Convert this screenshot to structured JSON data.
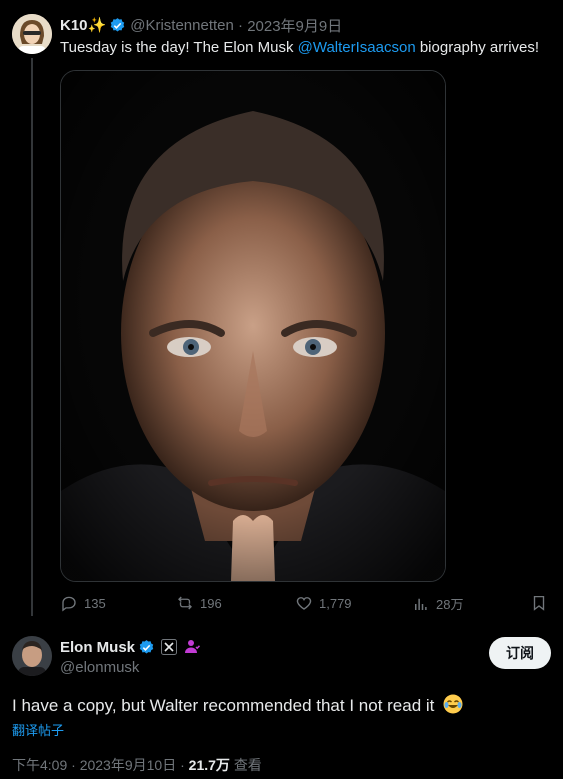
{
  "tweet": {
    "author_name": "K10",
    "author_name_emoji": "✨",
    "handle": "@Kristennetten",
    "date": "2023年9月9日",
    "text_prefix": "Tuesday is the day! The Elon Musk ",
    "mention": "@WalterIsaacson",
    "text_suffix": " biography arrives!",
    "actions": {
      "replies": "135",
      "reposts": "196",
      "likes": "1,779",
      "views": "28万"
    }
  },
  "reply": {
    "author_name": "Elon Musk",
    "handle": "@elonmusk",
    "follow_label": "订阅",
    "text": "I have a copy, but Walter recommended that I not read it",
    "translate_label": "翻译帖子",
    "time": "下午4:09",
    "date": "2023年9月10日",
    "views_count": "21.7万",
    "views_label": "查看"
  },
  "colors": {
    "background": "#000000",
    "text": "#e7e9ea",
    "muted": "#71767b",
    "link": "#1d9bf0",
    "verified": "#1d9bf0",
    "affiliate": "#c23bd4"
  },
  "icons": [
    "verified-icon",
    "reply-icon",
    "repost-icon",
    "like-icon",
    "views-icon",
    "bookmark-icon",
    "x-badge-icon",
    "affiliate-icon",
    "joy-emoji"
  ]
}
